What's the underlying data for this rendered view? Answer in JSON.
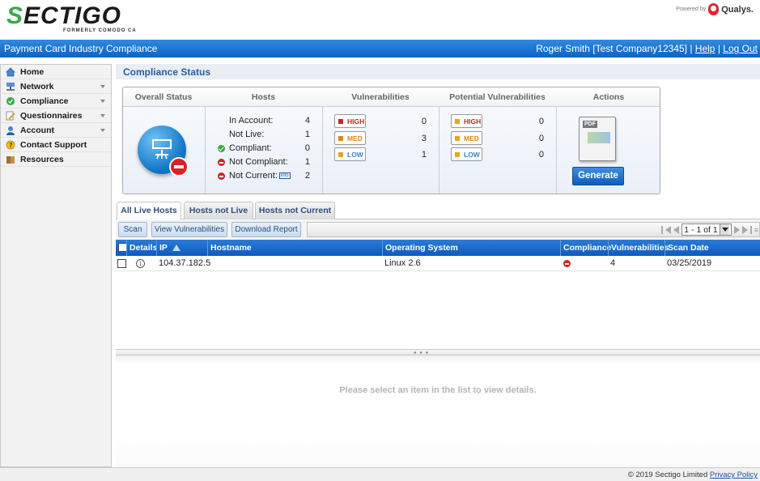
{
  "brand": {
    "logo_s": "S",
    "logo_rest": "ECTIGO",
    "logo_sub": "FORMERLY COMODO CA",
    "powered_by": "Powered by",
    "qualys": "Qualys."
  },
  "header": {
    "app_title": "Payment Card Industry Compliance",
    "user": "Roger Smith [Test Company12345]",
    "separator1": "|",
    "separator2": "|",
    "help": "Help",
    "logout": "Log Out"
  },
  "sidebar": {
    "items": [
      {
        "label": "Home",
        "icon": "home-icon",
        "has_arrow": false
      },
      {
        "label": "Network",
        "icon": "network-icon",
        "has_arrow": true
      },
      {
        "label": "Compliance",
        "icon": "compliance-icon",
        "has_arrow": true
      },
      {
        "label": "Questionnaires",
        "icon": "questionnaire-icon",
        "has_arrow": true
      },
      {
        "label": "Account",
        "icon": "account-icon",
        "has_arrow": true
      },
      {
        "label": "Contact Support",
        "icon": "support-icon",
        "has_arrow": false
      },
      {
        "label": "Resources",
        "icon": "book-icon",
        "has_arrow": false
      }
    ]
  },
  "compliance_status": {
    "title": "Compliance Status",
    "columns": {
      "overall": "Overall Status",
      "hosts": "Hosts",
      "vulnerabilities": "Vulnerabilities",
      "potential": "Potential Vulnerabilities",
      "actions": "Actions"
    },
    "hosts": {
      "in_account_label": "In Account:",
      "in_account": "4",
      "not_live_label": "Not Live:",
      "not_live": "1",
      "compliant_label": "Compliant:",
      "compliant": "0",
      "not_compliant_label": "Not Compliant:",
      "not_compliant": "1",
      "not_current_label": "Not Current:",
      "not_current_info": "info",
      "not_current": "2"
    },
    "vulnerabilities": {
      "high_label": "HIGH",
      "high": "0",
      "med_label": "MED",
      "med": "3",
      "low_label": "LOW",
      "low": "1"
    },
    "potential": {
      "high_label": "HIGH",
      "high": "0",
      "med_label": "MED",
      "med": "0",
      "low_label": "LOW",
      "low": "0"
    },
    "actions": {
      "pdf_label": "PDF",
      "generate": "Generate"
    }
  },
  "tabs": [
    {
      "label": "All Live Hosts",
      "active": true
    },
    {
      "label": "Hosts not Live",
      "active": false
    },
    {
      "label": "Hosts not Current",
      "active": false
    }
  ],
  "toolbar": {
    "scan": "Scan",
    "view_vulnerabilities": "View Vulnerabilities",
    "download_report": "Download Report",
    "pager_text": "1 - 1 of 1"
  },
  "table": {
    "columns": [
      "Details",
      "IP",
      "Hostname",
      "Operating System",
      "Compliance",
      "Vulnerabilities",
      "Scan Date"
    ],
    "rows": [
      {
        "ip": "104.37.182.5",
        "hostname": "",
        "os": "Linux 2.6",
        "compliance": "non-compliant",
        "vulnerabilities": "4",
        "scan_date": "03/25/2019"
      }
    ]
  },
  "details": {
    "empty_message": "Please select an item in the list to view details."
  },
  "footer": {
    "copyright": "© 2019 Sectigo Limited",
    "privacy": "Privacy Policy"
  },
  "colors": {
    "brand_blue": "#0d63c2",
    "sectigo_green": "#39a845",
    "high_red": "#d42020",
    "med_orange": "#e0871a",
    "low_blue": "#3a7fc8"
  }
}
